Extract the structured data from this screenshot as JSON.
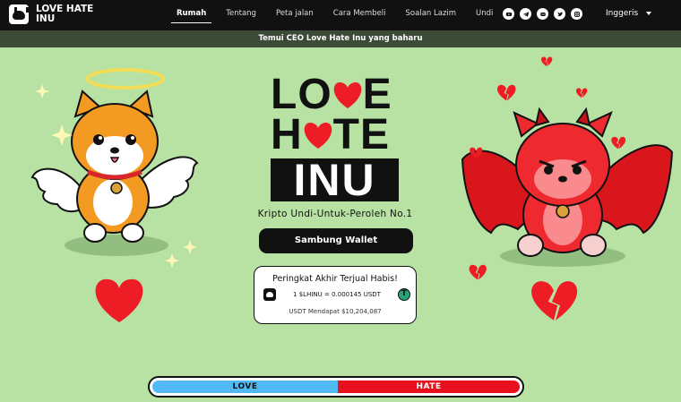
{
  "brand": {
    "line1": "LOVE HATE",
    "line2": "INU"
  },
  "nav": {
    "items": [
      {
        "label": "Rumah",
        "active": true
      },
      {
        "label": "Tentang",
        "active": false
      },
      {
        "label": "Peta jalan",
        "active": false
      },
      {
        "label": "Cara Membeli",
        "active": false
      },
      {
        "label": "Soalan Lazim",
        "active": false
      },
      {
        "label": "Undi",
        "active": false
      }
    ],
    "socials": [
      "youtube-icon",
      "telegram-icon",
      "discord-icon",
      "twitter-icon",
      "instagram-icon"
    ],
    "language": "Inggeris"
  },
  "announcement": "Temui CEO Love Hate Inu yang baharu",
  "hero": {
    "logo": {
      "line1_left": "LO",
      "line1_right": "E",
      "line2_left": "H",
      "line2_right": "TE",
      "line3": "INU"
    },
    "tagline": "Kripto Undi-Untuk-Peroleh No.1",
    "connect_button": "Sambung Wallet"
  },
  "presale_card": {
    "title": "Peringkat Akhir Terjual Habis!",
    "rate": "1 $LHINU = 0.000145 USDT",
    "token_symbol": "T",
    "raised": "USDT Mendapat $10,204,087"
  },
  "vote_bar": {
    "love_label": "LOVE",
    "hate_label": "HATE",
    "love_fraction": 0.505
  },
  "colors": {
    "background": "#b7e2a3",
    "nav": "#111111",
    "announcement": "#3c4a38",
    "love": "#52b9f5",
    "hate": "#e8101c",
    "heart": "#ee1d25",
    "tether": "#26a17b"
  }
}
